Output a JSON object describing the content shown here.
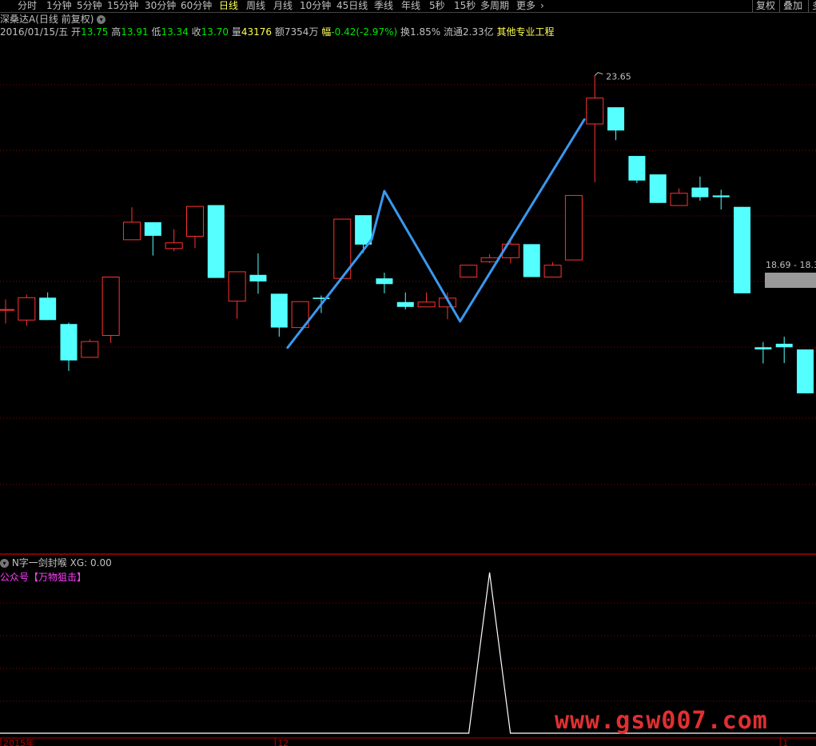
{
  "periods": [
    "分时",
    "1分钟",
    "5分钟",
    "15分钟",
    "30分钟",
    "60分钟",
    "日线",
    "周线",
    "月线",
    "10分钟",
    "45日线",
    "季线",
    "年线",
    "5秒",
    "15秒",
    "多周期",
    "更多"
  ],
  "active_period": "日线",
  "right_buttons": [
    "复权",
    "叠加",
    "多"
  ],
  "stock": {
    "name": "深桑达A",
    "mode": "(日线 前复权)"
  },
  "info": {
    "date": "2016/01/15/五",
    "open_label": "开",
    "open": "13.75",
    "high_label": "高",
    "high": "13.91",
    "low_label": "低",
    "low": "13.34",
    "close_label": "收",
    "close": "13.70",
    "vol_label": "量",
    "vol": "43176",
    "amt_label": "额",
    "amt": "7354万",
    "chg_label": "幅",
    "chg": "-0.42(-2.97%)",
    "turnover": "换1.85%",
    "float": "流通2.33亿",
    "other": "其他专业工程"
  },
  "price_tag": "18.69 - 18.3",
  "sub": {
    "title": "N字一剑封喉",
    "xg_label": "XG:",
    "xg_value": "0.00",
    "note": "公众号【万物狙击】"
  },
  "watermark": "www.gsw007.com",
  "colors": {
    "up": "#ff3232",
    "down": "#54ffff",
    "trend": "#3a98f0",
    "grid": "#8b0000",
    "bg": "#000000"
  },
  "chart_data": {
    "type": "candlestick",
    "main_annotations": {
      "max_label": "23.65"
    },
    "x_axis_labels": [
      {
        "text": "2015年",
        "index": 0
      },
      {
        "text": "12",
        "index": 13
      },
      {
        "text": "1",
        "index": 37
      }
    ],
    "price_range": [
      12.8,
      24.5
    ],
    "candles": [
      {
        "o": 18.32,
        "c": 18.32,
        "h": 18.55,
        "l": 18.0
      },
      {
        "o": 18.08,
        "c": 18.59,
        "h": 18.66,
        "l": 17.95
      },
      {
        "o": 18.59,
        "c": 18.08,
        "h": 18.71,
        "l": 18.08
      },
      {
        "o": 17.99,
        "c": 17.16,
        "h": 18.02,
        "l": 16.92
      },
      {
        "o": 17.23,
        "c": 17.59,
        "h": 17.64,
        "l": 17.23
      },
      {
        "o": 17.73,
        "c": 19.06,
        "h": 19.06,
        "l": 17.56
      },
      {
        "o": 19.91,
        "c": 20.31,
        "h": 20.65,
        "l": 19.91
      },
      {
        "o": 20.31,
        "c": 20.0,
        "h": 20.31,
        "l": 19.55
      },
      {
        "o": 19.71,
        "c": 19.84,
        "h": 20.15,
        "l": 19.65
      },
      {
        "o": 19.99,
        "c": 20.67,
        "h": 20.67,
        "l": 19.72
      },
      {
        "o": 20.7,
        "c": 19.04,
        "h": 20.7,
        "l": 19.04
      },
      {
        "o": 18.51,
        "c": 19.18,
        "h": 19.18,
        "l": 18.11
      },
      {
        "o": 19.11,
        "c": 18.96,
        "h": 19.6,
        "l": 18.68
      },
      {
        "o": 18.68,
        "c": 17.91,
        "h": 18.68,
        "l": 17.7
      },
      {
        "o": 17.91,
        "c": 18.5,
        "h": 18.5,
        "l": 17.91
      },
      {
        "o": 18.59,
        "c": 18.56,
        "h": 18.64,
        "l": 18.24
      },
      {
        "o": 19.03,
        "c": 20.38,
        "h": 20.38,
        "l": 19.03
      },
      {
        "o": 20.47,
        "c": 19.8,
        "h": 20.47,
        "l": 19.61
      },
      {
        "o": 19.03,
        "c": 18.9,
        "h": 19.16,
        "l": 18.69
      },
      {
        "o": 18.49,
        "c": 18.38,
        "h": 18.71,
        "l": 18.32
      },
      {
        "o": 18.38,
        "c": 18.49,
        "h": 18.71,
        "l": 18.38
      },
      {
        "o": 18.38,
        "c": 18.58,
        "h": 18.71,
        "l": 18.1
      },
      {
        "o": 19.06,
        "c": 19.33,
        "h": 19.33,
        "l": 19.06
      },
      {
        "o": 19.41,
        "c": 19.5,
        "h": 19.58,
        "l": 19.38
      },
      {
        "o": 19.5,
        "c": 19.81,
        "h": 19.88,
        "l": 19.37
      },
      {
        "o": 19.81,
        "c": 19.06,
        "h": 19.81,
        "l": 19.06
      },
      {
        "o": 19.06,
        "c": 19.33,
        "h": 19.4,
        "l": 19.06
      },
      {
        "o": 19.45,
        "c": 20.92,
        "h": 20.92,
        "l": 19.45
      },
      {
        "o": 22.55,
        "c": 23.14,
        "h": 23.65,
        "l": 21.22
      },
      {
        "o": 22.93,
        "c": 22.4,
        "h": 22.93,
        "l": 22.18
      },
      {
        "o": 21.82,
        "c": 21.26,
        "h": 21.82,
        "l": 21.2
      },
      {
        "o": 21.4,
        "c": 20.75,
        "h": 21.4,
        "l": 20.75
      },
      {
        "o": 20.69,
        "c": 20.97,
        "h": 21.08,
        "l": 20.69
      },
      {
        "o": 21.1,
        "c": 20.88,
        "h": 21.35,
        "l": 20.8
      },
      {
        "o": 20.92,
        "c": 20.88,
        "h": 21.05,
        "l": 20.6
      },
      {
        "o": 20.66,
        "c": 18.69,
        "h": 20.66,
        "l": 18.69
      },
      {
        "o": 17.46,
        "c": 17.41,
        "h": 17.58,
        "l": 17.09
      },
      {
        "o": 17.54,
        "c": 17.46,
        "h": 17.7,
        "l": 17.1
      },
      {
        "o": 17.41,
        "c": 16.41,
        "h": 17.41,
        "l": 16.41
      }
    ],
    "trend_line": [
      {
        "index": 13.4,
        "price": 17.45
      },
      {
        "index": 17.4,
        "price": 19.92
      },
      {
        "index": 18.0,
        "price": 21.02
      },
      {
        "index": 21.6,
        "price": 18.05
      },
      {
        "index": 27.5,
        "price": 22.65
      }
    ],
    "xg_indicator": {
      "values": [
        0,
        0,
        0,
        0,
        0,
        0,
        0,
        0,
        0,
        0,
        0,
        0,
        0,
        0,
        0,
        0,
        0,
        0,
        0,
        0,
        0,
        0,
        0,
        1,
        0,
        0,
        0,
        0,
        0,
        0,
        0,
        0,
        0,
        0,
        0,
        0,
        0,
        0,
        0
      ]
    }
  }
}
